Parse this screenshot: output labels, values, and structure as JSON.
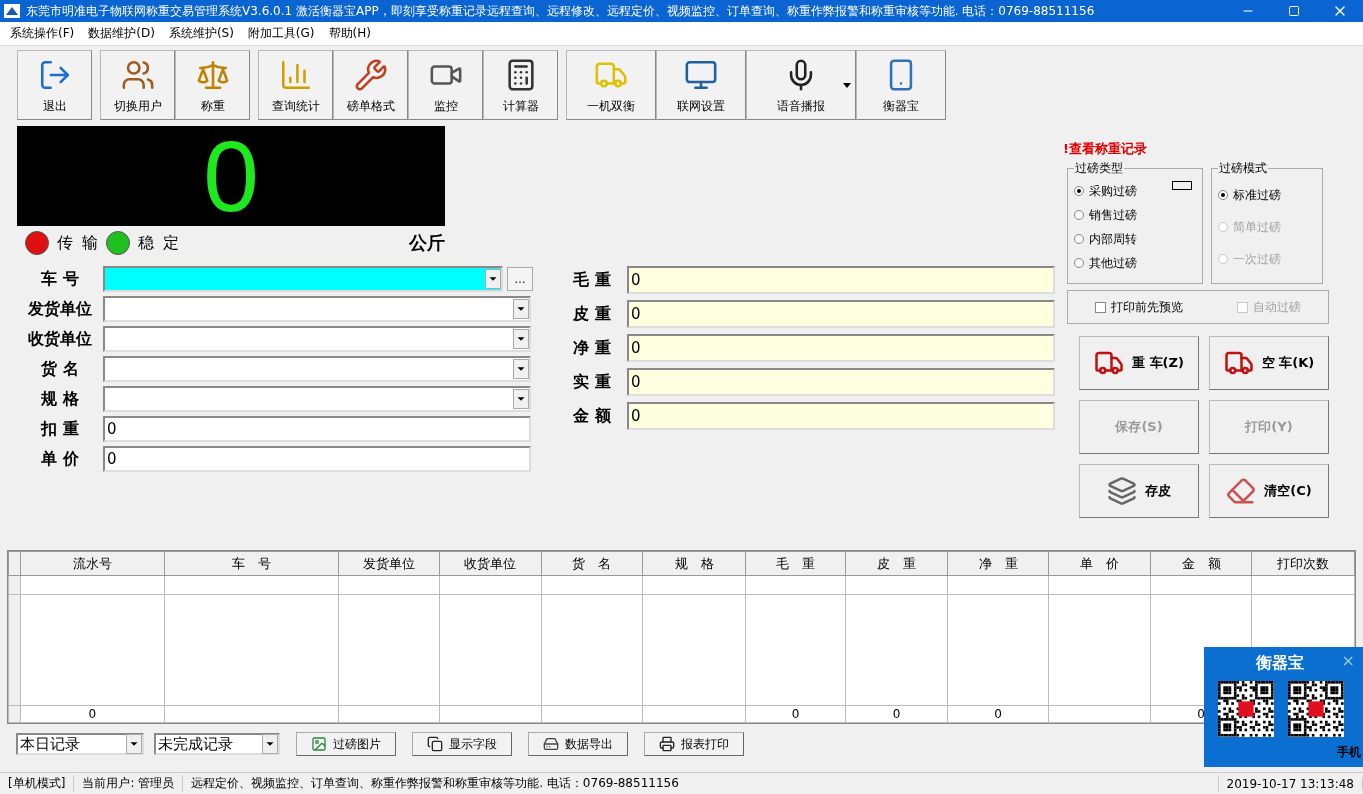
{
  "window": {
    "title": "东莞市明准电子物联网称重交易管理系统V3.6.0.1 激活衡器宝APP，即刻享受称重记录远程查询、远程修改、远程定价、视频监控、订单查询、称重作弊报警和称重审核等功能. 电话：0769-88511156"
  },
  "menu": [
    "系统操作(F)",
    "数据维护(D)",
    "系统维护(S)",
    "附加工具(G)",
    "帮助(H)"
  ],
  "toolbar_groups": [
    [
      {
        "label": "退出",
        "dropdown": false
      }
    ],
    [
      {
        "label": "切换用户",
        "dropdown": false
      },
      {
        "label": "称重",
        "dropdown": false
      }
    ],
    [
      {
        "label": "查询统计",
        "dropdown": false
      },
      {
        "label": "磅单格式",
        "dropdown": false
      },
      {
        "label": "监控",
        "dropdown": false
      },
      {
        "label": "计算器",
        "dropdown": false
      }
    ],
    [
      {
        "label": "一机双衡",
        "dropdown": false
      },
      {
        "label": "联网设置",
        "dropdown": false
      },
      {
        "label": "语音播报",
        "dropdown": true
      },
      {
        "label": "衡器宝",
        "dropdown": false
      }
    ]
  ],
  "display": {
    "reading": "0",
    "unit": "公斤"
  },
  "indicators": [
    {
      "label": "传 输",
      "color": "#e01010"
    },
    {
      "label": "稳 定",
      "color": "#20c020"
    }
  ],
  "form_left": [
    {
      "label": "车 号",
      "kind": "combo",
      "highlighted": true,
      "extra_button": "…"
    },
    {
      "label": "发货单位",
      "kind": "combo",
      "highlighted": false
    },
    {
      "label": "收货单位",
      "kind": "combo",
      "highlighted": false
    },
    {
      "label": "货 名",
      "kind": "combo",
      "highlighted": false
    },
    {
      "label": "规 格",
      "kind": "combo",
      "highlighted": false
    },
    {
      "label": "扣 重",
      "kind": "text",
      "value": "0",
      "highlighted": false
    },
    {
      "label": "单 价",
      "kind": "text",
      "value": "0",
      "highlighted": false
    }
  ],
  "form_right": [
    {
      "label": "毛 重",
      "value": "0"
    },
    {
      "label": "皮 重",
      "value": "0"
    },
    {
      "label": "净 重",
      "value": "0"
    },
    {
      "label": "实 重",
      "value": "0"
    },
    {
      "label": "金 额",
      "value": "0"
    }
  ],
  "records_link": "!查看称重记录",
  "weigh_type": {
    "title": "过磅类型",
    "options": [
      {
        "label": "采购过磅",
        "selected": true,
        "disabled": false
      },
      {
        "label": "销售过磅",
        "selected": false,
        "disabled": false
      },
      {
        "label": "内部周转",
        "selected": false,
        "disabled": false
      },
      {
        "label": "其他过磅",
        "selected": false,
        "disabled": false
      }
    ]
  },
  "weigh_mode": {
    "title": "过磅模式",
    "options": [
      {
        "label": "标准过磅",
        "selected": true,
        "disabled": false
      },
      {
        "label": "简单过磅",
        "selected": false,
        "disabled": true
      },
      {
        "label": "一次过磅",
        "selected": false,
        "disabled": true
      }
    ]
  },
  "checkboxes": [
    {
      "label": "打印前先预览",
      "checked": false,
      "disabled": false
    },
    {
      "label": "自动过磅",
      "checked": false,
      "disabled": true
    }
  ],
  "actions": [
    {
      "label": "重 车(Z)",
      "disabled": false
    },
    {
      "label": "空 车(K)",
      "disabled": false
    },
    {
      "label": "保存(S)",
      "disabled": true
    },
    {
      "label": "打印(Y)",
      "disabled": true
    },
    {
      "label": "存皮",
      "disabled": false
    },
    {
      "label": "清空(C)",
      "disabled": false
    }
  ],
  "table": {
    "columns": [
      {
        "label": "流水号",
        "total": "0"
      },
      {
        "label": "车　号"
      },
      {
        "label": "发货单位"
      },
      {
        "label": "收货单位"
      },
      {
        "label": "货　名"
      },
      {
        "label": "规　格"
      },
      {
        "label": "毛　重",
        "total": "0"
      },
      {
        "label": "皮　重",
        "total": "0"
      },
      {
        "label": "净　重",
        "total": "0"
      },
      {
        "label": "单　价"
      },
      {
        "label": "金　额",
        "total": "0"
      },
      {
        "label": "打印次数"
      }
    ]
  },
  "filters": [
    {
      "value": "本日记录"
    },
    {
      "value": "未完成记录"
    }
  ],
  "bottom_buttons": [
    "过磅图片",
    "显示字段",
    "数据导出",
    "报表打印"
  ],
  "status_bar": [
    "[单机模式]",
    "当前用户: 管理员",
    "远程定价、视频监控、订单查询、称重作弊报警和称重审核等功能. 电话：0769-88511156",
    "2019-10-17 13:13:48"
  ],
  "popup": {
    "title": "衡器宝",
    "close": "×",
    "caption": "手机"
  }
}
